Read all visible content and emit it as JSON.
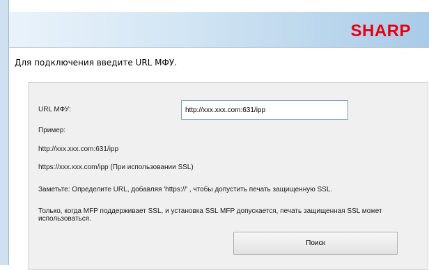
{
  "brand": {
    "logo_text": "SHARP",
    "logo_color": "#e60012"
  },
  "instruction": "Для подключения введите URL МФУ.",
  "form": {
    "url_label": "URL МФУ:",
    "url_value": "http://xxx.xxx.com:631/ipp"
  },
  "examples": {
    "heading": "Пример:",
    "http_example": "http://xxx.xxx.com:631/ipp",
    "https_example": "https://xxx.xxx.com/ipp (При использовании SSL)"
  },
  "notes": {
    "ssl_note": "Заметьте: Определите URL, добавляя 'https://' , чтобы допустить печать защищенную SSL.",
    "ssl_support_note": "Только, когда MFP поддерживает SSL, и установка SSL MFP допускается, печать защищенная SSL может использоваться."
  },
  "buttons": {
    "search_label": "Поиск"
  },
  "colors": {
    "header_accent": "#a9cbe7",
    "panel_bg": "#f0f0f0"
  }
}
